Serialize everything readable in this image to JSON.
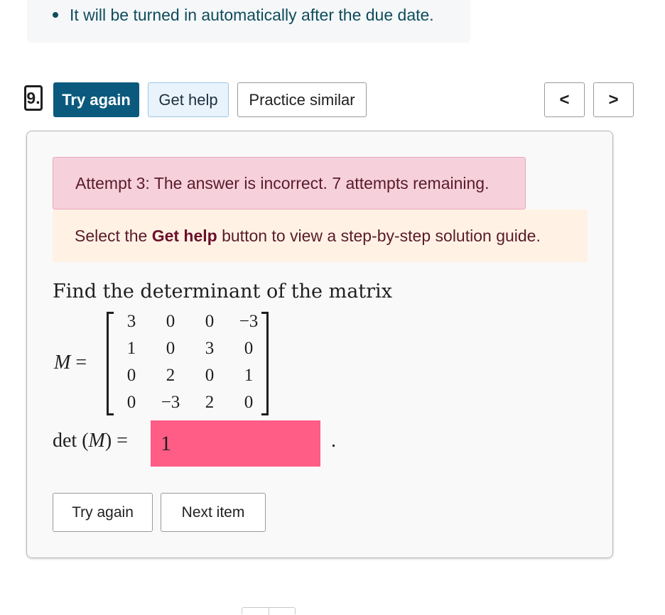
{
  "info": {
    "items": [
      "It will be turned in automatically after the due date."
    ]
  },
  "toolbar": {
    "question_number": "9.",
    "try_again": "Try again",
    "get_help": "Get help",
    "practice_similar": "Practice similar",
    "prev_glyph": "<",
    "next_glyph": ">"
  },
  "card": {
    "error_message": "Attempt 3: The answer is incorrect. 7 attempts remaining.",
    "hint_prefix": "Select the ",
    "hint_bold": "Get help",
    "hint_suffix": " button to view a step-by-step solution guide.",
    "prompt": "Find the determinant of the matrix",
    "matrix_label": "M",
    "equals": "=",
    "matrix": [
      [
        "3",
        "0",
        "0",
        "−3"
      ],
      [
        "1",
        "0",
        "3",
        "0"
      ],
      [
        "0",
        "2",
        "0",
        "1"
      ],
      [
        "0",
        "−3",
        "2",
        "0"
      ]
    ],
    "det_prefix": "det (",
    "det_var": "M",
    "det_suffix": ") =",
    "answer_value": "1",
    "answer_status": "incorrect",
    "answer_color": "#ff5c86",
    "period": ".",
    "try_again": "Try again",
    "next_item": "Next item"
  }
}
